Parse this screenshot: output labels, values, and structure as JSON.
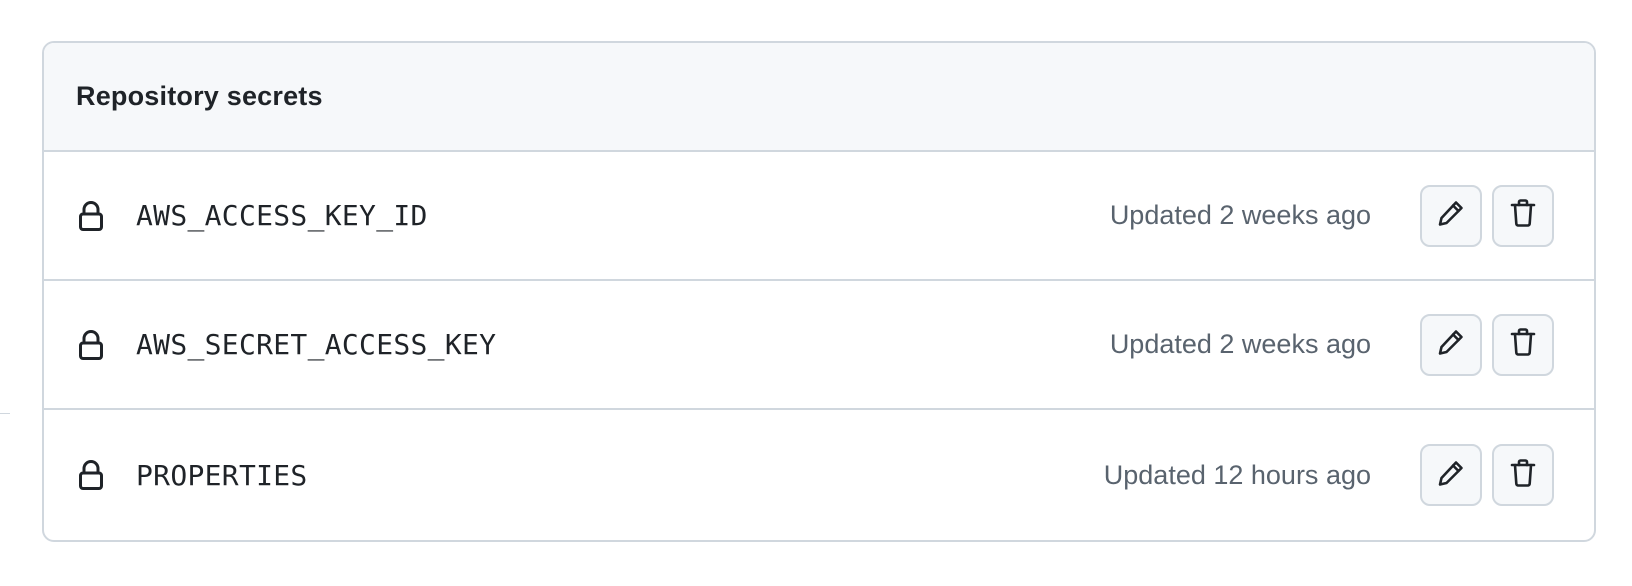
{
  "box": {
    "title": "Repository secrets"
  },
  "secrets": [
    {
      "name": "AWS_ACCESS_KEY_ID",
      "updated": "Updated 2 weeks ago",
      "icon": "lock-icon",
      "actions": [
        "pencil-icon",
        "trash-icon"
      ]
    },
    {
      "name": "AWS_SECRET_ACCESS_KEY",
      "updated": "Updated 2 weeks ago",
      "icon": "lock-icon",
      "actions": [
        "pencil-icon",
        "trash-icon"
      ]
    },
    {
      "name": "PROPERTIES",
      "updated": "Updated 12 hours ago",
      "icon": "lock-icon",
      "actions": [
        "pencil-icon",
        "trash-icon"
      ]
    }
  ],
  "colors": {
    "header_bg": "#f6f8fa",
    "border": "#d0d7de",
    "text": "#1f2328",
    "muted": "#59636e"
  }
}
